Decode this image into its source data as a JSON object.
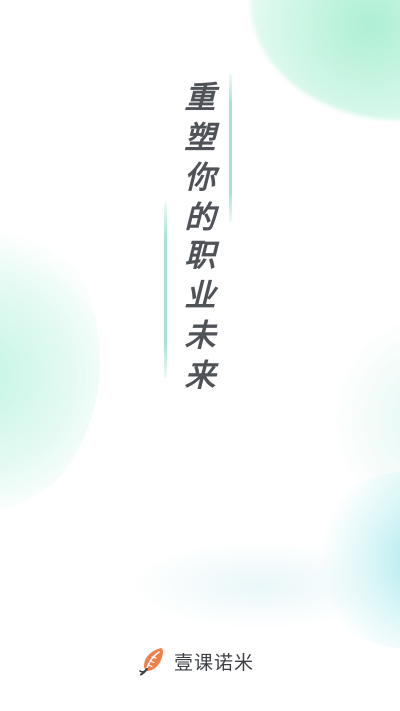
{
  "slogan": {
    "line1": [
      "重",
      "塑",
      "你",
      "的"
    ],
    "line2": [
      "职",
      "业",
      "未",
      "来"
    ]
  },
  "brand": {
    "name": "壹课诺米",
    "logo_icon": "feather-quill-icon",
    "logo_colors": [
      "#f07f4a",
      "#3c3f44"
    ]
  },
  "colors": {
    "background": "#ffffff",
    "text": "#4f5358",
    "accent_line": "#a8e2d6",
    "glow_green": "#a0eccd",
    "glow_cyan": "#96e1e8"
  }
}
